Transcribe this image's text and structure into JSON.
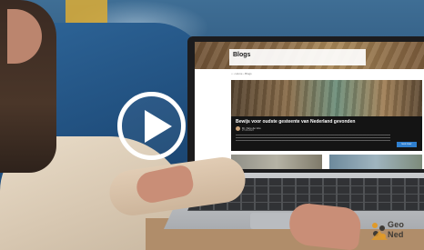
{
  "video": {
    "play_label": ""
  },
  "website": {
    "banner_title": "Blogs",
    "breadcrumb": "⌂ › Home › Blogs",
    "article": {
      "title": "Bewijs voor oudste gesteente van Nederland gevonden",
      "author": "Dr. Nico de Vos",
      "date": "27-09-2023",
      "button": "lees meer"
    }
  },
  "logo": {
    "line1": "Geo",
    "line2": "Ned"
  },
  "colors": {
    "play_button": "#ffffff",
    "article_card": "#141414",
    "read_more": "#2f7fcf",
    "logo_orange": "#e09a2a"
  }
}
